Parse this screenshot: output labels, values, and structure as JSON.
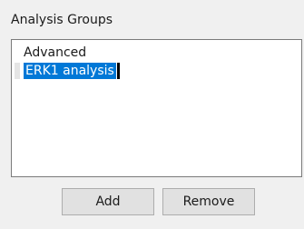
{
  "panel": {
    "title": "Analysis Groups"
  },
  "list": {
    "items": [
      {
        "label": "Advanced"
      },
      {
        "label": "ERK1 analysis",
        "editing": true,
        "selected_text": "ERK1 analysis"
      }
    ]
  },
  "buttons": {
    "add_label": "Add",
    "remove_label": "Remove"
  },
  "colors": {
    "selection": "#0078d7",
    "background": "#f0f0f0",
    "list_background": "#ffffff",
    "button_background": "#e1e1e1",
    "border": "#adadad"
  }
}
